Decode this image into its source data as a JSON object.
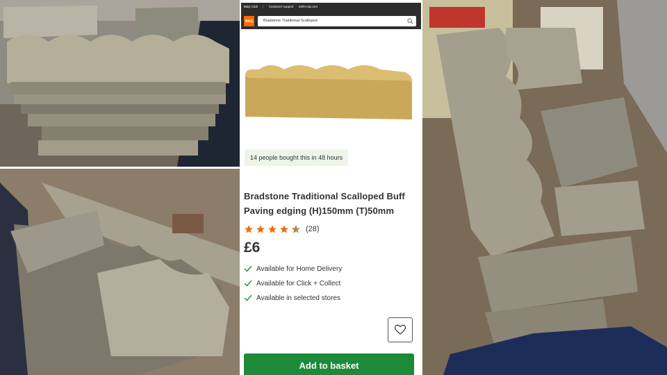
{
  "header": {
    "top_links": [
      "B&Q Club",
      "Customer support",
      "Seller.dq.com"
    ],
    "logo_text": "B&Q",
    "search_value": "Bradstone Traditional Scalloped"
  },
  "product": {
    "social_proof": "14 people bought this in 48 hours",
    "title": "Bradstone Traditional Scalloped Buff Paving edging (H)150mm (T)50mm",
    "rating": 4.5,
    "review_count": "(28)",
    "price": "£6",
    "availability": [
      "Available for Home Delivery",
      "Available for Click + Collect",
      "Available in selected stores"
    ],
    "add_to_basket": "Add to basket"
  },
  "colors": {
    "accent_green": "#1d8a3a",
    "star_orange": "#e8730c",
    "header_dark": "#2d2d2d",
    "brand_orange": "#ff6a00"
  },
  "icons": [
    "search-icon",
    "star-icon",
    "check-icon",
    "heart-icon"
  ]
}
